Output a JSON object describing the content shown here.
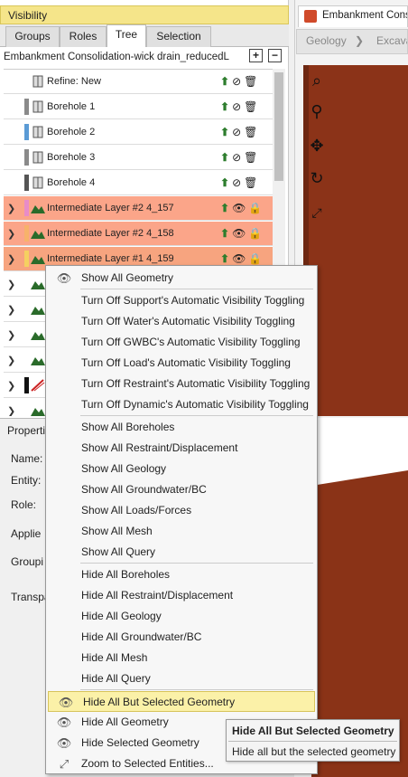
{
  "visibility": {
    "title": "Visibility",
    "tabs": [
      "Groups",
      "Roles",
      "Tree",
      "Selection"
    ],
    "active_tab": "Tree",
    "model_name": "Embankment Consolidation-wick drain_reducedL",
    "tree": [
      {
        "label": "Refine: New",
        "kind": "refine",
        "color": "#ffffff"
      },
      {
        "label": "Borehole 1",
        "kind": "borehole",
        "color": "#8a8a8a"
      },
      {
        "label": "Borehole 2",
        "kind": "borehole",
        "color": "#5b9bd5"
      },
      {
        "label": "Borehole 3",
        "kind": "borehole",
        "color": "#8a8a8a"
      },
      {
        "label": "Borehole 4",
        "kind": "borehole",
        "color": "#555555"
      },
      {
        "label": "Intermediate Layer #2 4_157",
        "kind": "layer",
        "color": "#e88cc8"
      },
      {
        "label": "Intermediate Layer #2 4_158",
        "kind": "layer",
        "color": "#f7b26a"
      },
      {
        "label": "Intermediate Layer #1 4_159",
        "kind": "layer",
        "color": "#f5d060"
      },
      {
        "label": "",
        "kind": "layer-plain",
        "color": "#ffffff"
      },
      {
        "label": "",
        "kind": "layer-plain",
        "color": "#ffffff"
      },
      {
        "label": "",
        "kind": "layer-plain",
        "color": "#ffffff"
      },
      {
        "label": "",
        "kind": "layer-plain",
        "color": "#ffffff"
      },
      {
        "label": "",
        "kind": "support",
        "color": "#111111"
      },
      {
        "label": "",
        "kind": "other",
        "color": "#ffffff"
      }
    ]
  },
  "right_panel": {
    "tab_title": "Embankment Cons",
    "breadcrumbs": [
      "Geology",
      "Excava"
    ]
  },
  "properties": {
    "title": "Properti",
    "labels": [
      "Name:",
      "Entity:",
      "Role:",
      "Applie",
      "Groupi",
      "Transpa"
    ]
  },
  "context_menu": {
    "items": [
      {
        "label": "Show All Geometry",
        "icon": "eye-icon",
        "group": 1
      },
      {
        "label": "Turn Off Support's Automatic Visibility Toggling",
        "group": 2
      },
      {
        "label": "Turn Off Water's Automatic Visibility Toggling",
        "group": 2
      },
      {
        "label": "Turn Off GWBC's Automatic Visibility Toggling",
        "group": 2
      },
      {
        "label": "Turn Off Load's Automatic Visibility Toggling",
        "group": 2
      },
      {
        "label": "Turn Off Restraint's Automatic Visibility Toggling",
        "group": 2
      },
      {
        "label": "Turn Off Dynamic's Automatic Visibility Toggling",
        "group": 2
      },
      {
        "label": "Show All Boreholes",
        "group": 3
      },
      {
        "label": "Show All Restraint/Displacement",
        "group": 3
      },
      {
        "label": "Show All Geology",
        "group": 3
      },
      {
        "label": "Show All Groundwater/BC",
        "group": 3
      },
      {
        "label": "Show All Loads/Forces",
        "group": 3
      },
      {
        "label": "Show All Mesh",
        "group": 3
      },
      {
        "label": "Show All Query",
        "group": 3
      },
      {
        "label": "Hide All Boreholes",
        "group": 4
      },
      {
        "label": "Hide All Restraint/Displacement",
        "group": 4
      },
      {
        "label": "Hide All Geology",
        "group": 4
      },
      {
        "label": "Hide All Groundwater/BC",
        "group": 4
      },
      {
        "label": "Hide All Mesh",
        "group": 4
      },
      {
        "label": "Hide All Query",
        "group": 4
      },
      {
        "label": "Hide All But Selected Geometry",
        "icon": "eye-icon",
        "group": 5,
        "highlighted": true
      },
      {
        "label": "Hide All Geometry",
        "icon": "eye-icon",
        "group": 5
      },
      {
        "label": "Hide Selected Geometry",
        "icon": "eye-icon",
        "group": 5
      },
      {
        "label": "Zoom to Selected Entities...",
        "icon": "zoom-extents-icon",
        "group": 5
      }
    ]
  },
  "tooltip": {
    "title": "Hide All But Selected Geometry",
    "text": "Hide all but the selected geometry"
  }
}
